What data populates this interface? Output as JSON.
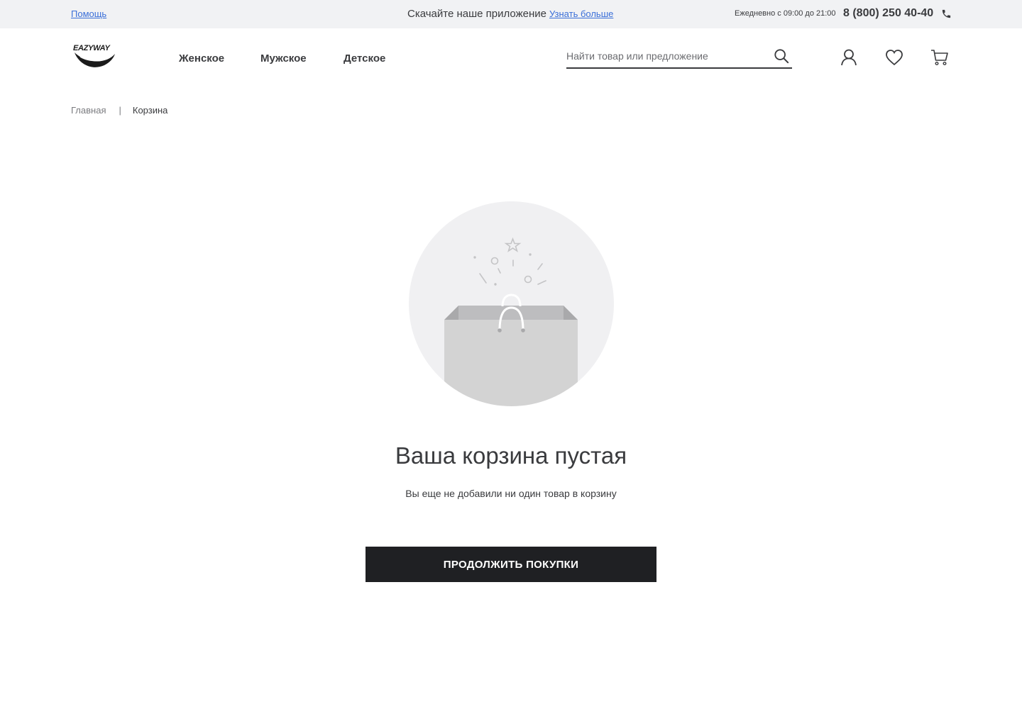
{
  "topbar": {
    "help_link": "Помощь",
    "promo_text": "Скачайте наше приложение",
    "learn_more_link": "Узнать больше",
    "hours": "Ежедневно с 09:00 до 21:00",
    "phone": "8 (800) 250 40-40",
    "phone_icon": "phone-icon"
  },
  "header": {
    "logo_text": "EAZYWAY",
    "nav": [
      "Женское",
      "Мужское",
      "Детское"
    ],
    "search_placeholder": "Найти товар или предложение",
    "search_value": "",
    "icons": [
      "search-icon",
      "user-icon",
      "heart-icon",
      "cart-icon"
    ]
  },
  "breadcrumb": {
    "home": "Главная",
    "current": "Корзина"
  },
  "empty_cart": {
    "illustration": "empty-shopping-bag",
    "title": "Ваша корзина пустая",
    "subtitle": "Вы еще не добавили ни один товар в корзину",
    "button_label": "ПРОДОЛЖИТЬ ПОКУПКИ"
  },
  "colors": {
    "link": "#3a6fd8",
    "topbar_bg": "#f1f2f4",
    "text": "#3a3b3e",
    "button_bg": "#1f2023",
    "illustration_bg": "#f0f0f2",
    "bag": "#d3d3d3"
  }
}
